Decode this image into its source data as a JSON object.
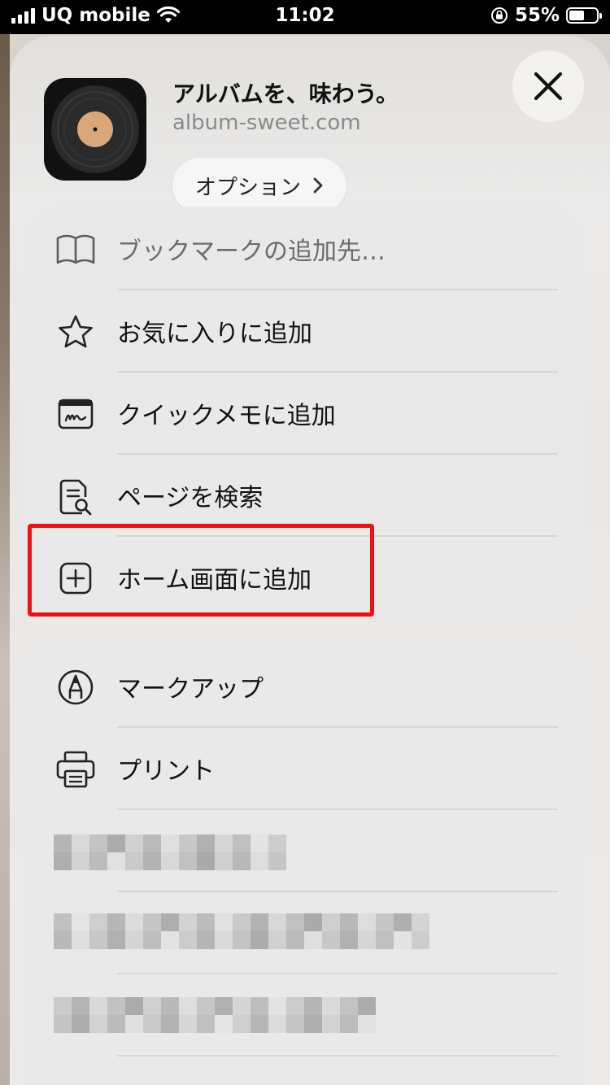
{
  "status_bar": {
    "carrier": "UQ mobile",
    "time": "11:02",
    "battery_percent": "55%",
    "battery_level": 0.55
  },
  "share_sheet": {
    "app_title": "アルバムを、味わう。",
    "app_url": "album-sweet.com",
    "options_label": "オプション",
    "close_icon": "close-icon"
  },
  "menu_group_1": [
    {
      "label": "ブックマークの追加先…",
      "icon": "book-icon"
    },
    {
      "label": "お気に入りに追加",
      "icon": "star-icon"
    },
    {
      "label": "クイックメモに追加",
      "icon": "quick-note-icon"
    },
    {
      "label": "ページを検索",
      "icon": "find-page-icon"
    },
    {
      "label": "ホーム画面に追加",
      "icon": "add-square-icon"
    }
  ],
  "menu_group_2": [
    {
      "label": "マークアップ",
      "icon": "markup-icon"
    },
    {
      "label": "プリント",
      "icon": "printer-icon"
    }
  ],
  "colors": {
    "highlight": "#ee1111",
    "sheet_bg": "#efefef",
    "group_bg": "#e9e9e9"
  }
}
